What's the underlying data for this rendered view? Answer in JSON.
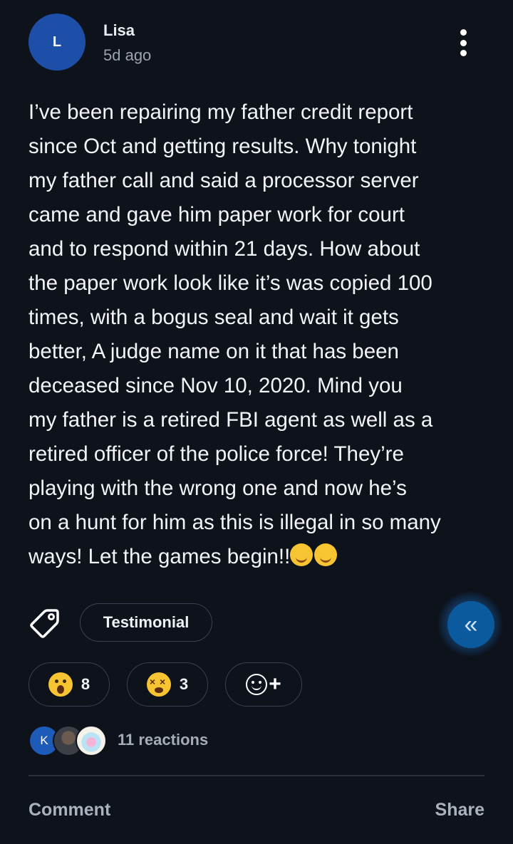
{
  "post": {
    "author_initial": "L",
    "author_name": "Lisa",
    "time_ago": "5d ago",
    "body_lines": [
      "I’ve been repairing my father credit report",
      "since Oct and getting results. Why tonight",
      "my father call and said a processor server",
      "came and gave him paper work for court",
      "and to respond within 21 days. How about",
      "the paper work look like it’s was copied 100",
      "times, with a bogus  seal and wait it gets",
      "better, A judge name on it that has been",
      "deceased since Nov 10, 2020. Mind you",
      "my father is a retired FBI agent as well as a",
      "retired officer of the police force!  They’re",
      "playing with the wrong one and now he’s",
      "on a hunt for him as this is illegal in so many",
      "ways! Let the games begin!!"
    ],
    "trailing_emojis": [
      "smiling-face-icon",
      "hand-over-mouth-face-icon"
    ]
  },
  "tag": {
    "icon": "tag-icon",
    "label": "Testimonial"
  },
  "fab": {
    "icon": "double-chevron-left-icon",
    "glyph": "«"
  },
  "reactions": [
    {
      "icon": "astonished-face-icon",
      "count": "8"
    },
    {
      "icon": "dizzy-face-icon",
      "count": "3"
    }
  ],
  "add_reaction": {
    "icon": "add-reaction-icon",
    "plus": "+"
  },
  "reactors": {
    "first_initial": "K",
    "summary": "11 reactions"
  },
  "actions": {
    "comment": "Comment",
    "share": "Share"
  },
  "colors": {
    "background": "#0d121b",
    "avatar": "#1d4fa8",
    "fab": "#0c5a9e",
    "muted_text": "#9aa3b0"
  }
}
